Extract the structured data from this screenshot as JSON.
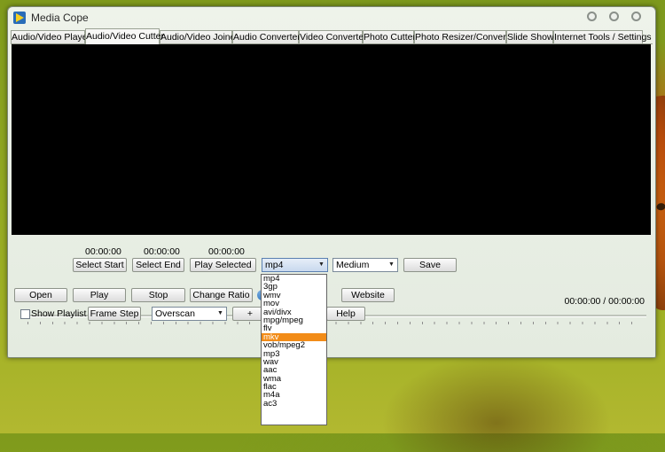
{
  "window": {
    "title": "Media Cope",
    "icon": "play-triangle-icon"
  },
  "tabs": [
    "Audio/Video Player",
    "Audio/Video Cutter",
    "Audio/Video Joiner",
    "Audio Converter",
    "Video Converter",
    "Photo Cutter",
    "Photo Resizer/Converter",
    "Slide Show",
    "Internet Tools / Settings"
  ],
  "active_tab": "Audio/Video Cutter",
  "cutter": {
    "start_time": "00:00:00",
    "end_time": "00:00:00",
    "selected_time": "00:00:00",
    "select_start": "Select Start",
    "select_end": "Select End",
    "play_selected": "Play Selected",
    "format_value": "mp4",
    "quality_value": "Medium",
    "save": "Save"
  },
  "controls": {
    "open": "Open",
    "play": "Play",
    "stop": "Stop",
    "change_ratio": "Change Ratio",
    "website": "Website",
    "time_display": "00:00:00 / 00:00:00",
    "show_playlist": "Show Playlist",
    "frame_step": "Frame Step",
    "scan_value": "Overscan",
    "plus": "+",
    "help": "Help"
  },
  "format_options": [
    "mp4",
    "3gp",
    "wmv",
    "mov",
    "avi/divx",
    "mpg/mpeg",
    "flv",
    "mkv",
    "vob/mpeg2",
    "mp3",
    "wav",
    "aac",
    "wma",
    "flac",
    "m4a",
    "ac3"
  ],
  "format_highlighted": "mkv",
  "colors": {
    "highlight": "#f28c18",
    "video_bg": "#000000"
  }
}
